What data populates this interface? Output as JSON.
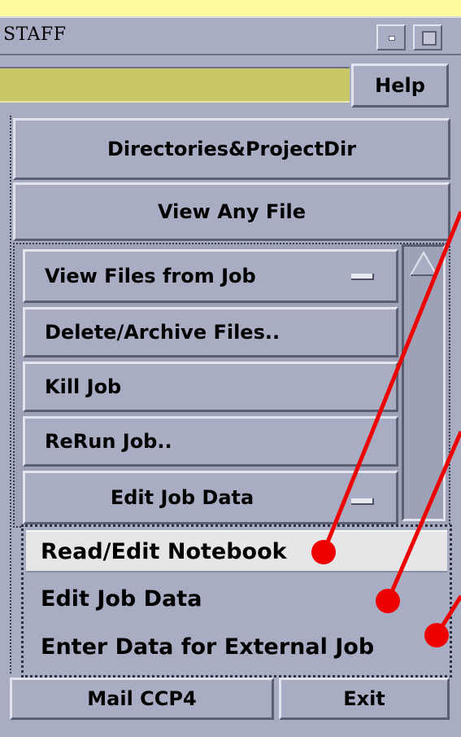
{
  "window": {
    "title": "STAFF"
  },
  "toolbar": {
    "help_label": "Help"
  },
  "buttons": {
    "directories": "Directories&ProjectDir",
    "view_any_file": "View Any File",
    "view_files_from_job": "View Files from Job",
    "delete_archive": "Delete/Archive Files..",
    "kill_job": "Kill Job",
    "rerun_job": "ReRun Job..",
    "edit_job_data": "Edit Job Data",
    "mail_ccp4": "Mail CCP4",
    "exit": "Exit"
  },
  "menu": {
    "items": [
      {
        "label": "Read/Edit Notebook",
        "active": true
      },
      {
        "label": "Edit Job Data",
        "active": false
      },
      {
        "label": "Enter Data for External Job",
        "active": false
      }
    ]
  },
  "annotation": {
    "color": "#ee0000"
  }
}
